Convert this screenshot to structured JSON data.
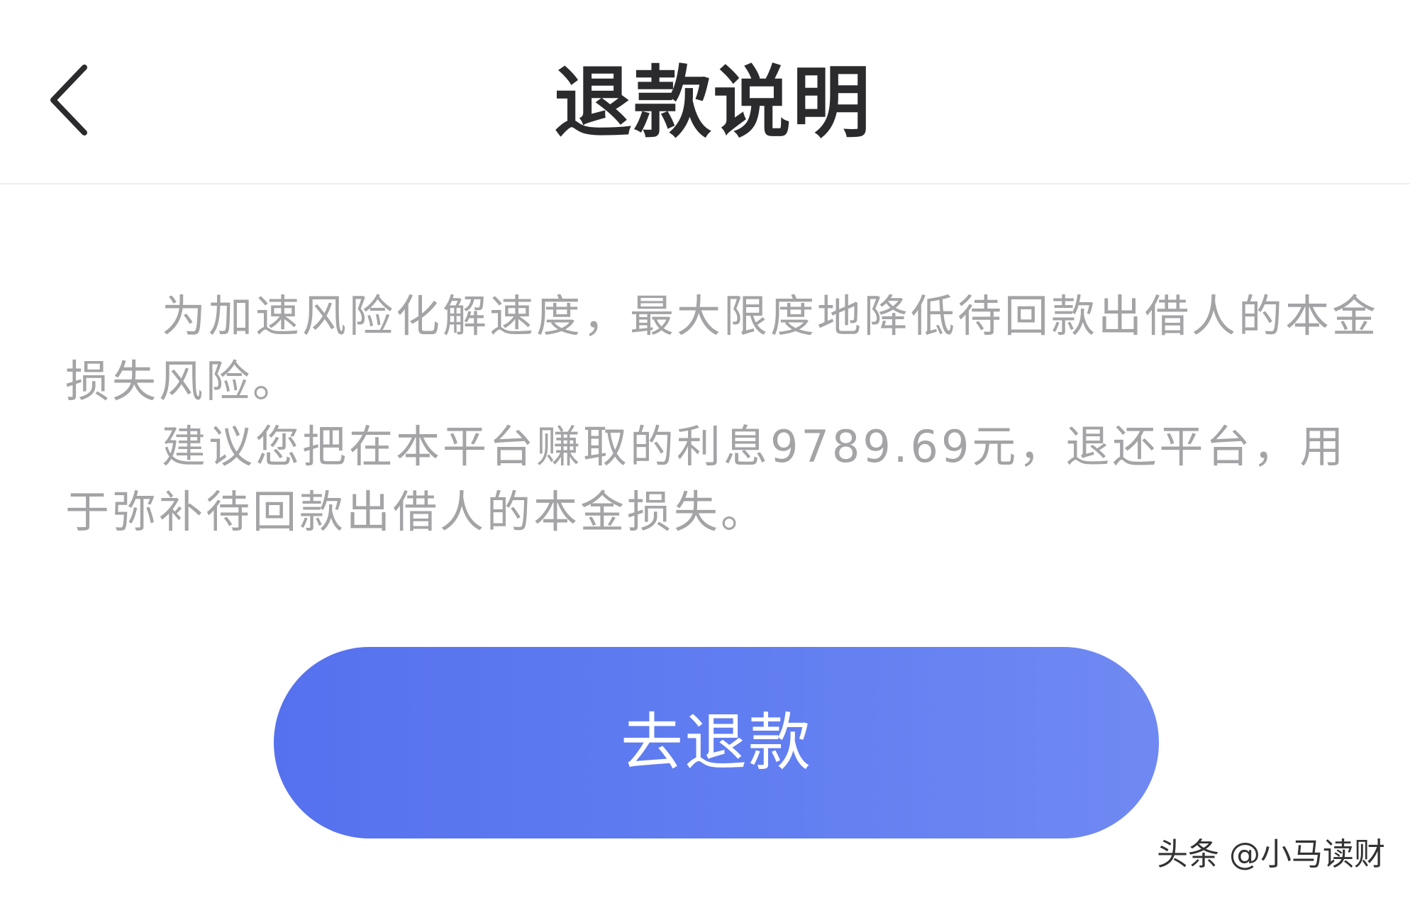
{
  "header": {
    "title": "退款说明",
    "back_icon": "chevron-left-icon"
  },
  "content": {
    "paragraph_1": "为加速风险化解速度，最大限度地降低待回款出借人的本金损失风险。",
    "paragraph_2": "建议您把在本平台赚取的利息9789.69元，退还平台，用于弥补待回款出借人的本金损失。"
  },
  "action": {
    "refund_label": "去退款"
  },
  "watermark": {
    "text": "头条 @小马读财"
  },
  "colors": {
    "button_start": "#5671ee",
    "button_end": "#7089f2",
    "title": "#2b2b2d",
    "body_text": "#a4a4a7"
  }
}
